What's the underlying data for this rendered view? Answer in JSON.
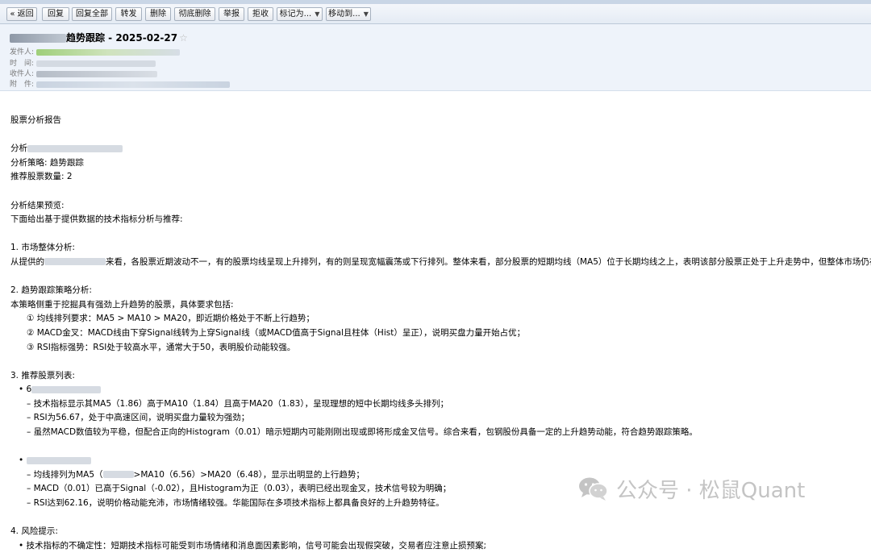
{
  "toolbar": {
    "back": "« 返回",
    "reply": "回复",
    "reply_all": "回复全部",
    "forward": "转发",
    "delete": "删除",
    "delete_perm": "彻底删除",
    "report": "举报",
    "reject": "拒收",
    "mark_as": "标记为...",
    "move_to": "移动到..."
  },
  "header": {
    "subject": "趋势跟踪 - 2025-02-27",
    "star": "☆",
    "from_label": "发件人:",
    "time_label": "时　间:",
    "to_label": "收件人:",
    "attach_label": "附　件:"
  },
  "body": {
    "title": "股票分析报告",
    "analysis_prefix": "分析",
    "strategy": "分析策略: 趋势跟踪",
    "count": "推荐股票数量: 2",
    "preview_title": "分析结果预览:",
    "preview_desc": "下面给出基于提供数据的技术指标分析与推荐:",
    "s1_title": "1. 市场整体分析:",
    "s1_prefix": "从提供的",
    "s1_text": "来看，各股票近期波动不一，有的股票均线呈现上升排列，有的则呈现宽幅震荡或下行排列。整体来看，部分股票的短期均线（MA5）位于长期均线之上，表明该部分股票正处于上升走势中，但整体市场仍存在分化现象，",
    "s2_title": "2. 趋势跟踪策略分析:",
    "s2_desc": "本策略侧重于挖掘具有强劲上升趋势的股票，具体要求包括:",
    "s2_items": [
      "① 均线排列要求：MA5 > MA10 > MA20，即近期价格处于不断上行趋势；",
      "② MACD金叉：MACD线由下穿Signal线转为上穿Signal线（或MACD值高于Signal且柱体（Hist）呈正），说明买盘力量开始占优；",
      "③ RSI指标强势：RSI处于较高水平，通常大于50，表明股价动能较强。"
    ],
    "s3_title": "3. 推荐股票列表:",
    "bullet": "•",
    "stock1_prefix": "6",
    "stock1_items": [
      "– 技术指标显示其MA5（1.86）高于MA10（1.84）且高于MA20（1.83），呈现理想的短中长期均线多头排列；",
      "– RSI为56.67，处于中高速区间，说明买盘力量较为强劲；",
      "– 虽然MACD数值较为平稳，但配合正向的Histogram（0.01）暗示短期内可能刚刚出现或即将形成金叉信号。综合来看，包钢股份具备一定的上升趋势动能，符合趋势跟踪策略。"
    ],
    "stock2_line1_a": "– 均线排列为MA5（",
    "stock2_line1_b": ">MA10（6.56）>MA20（6.48），显示出明显的上行趋势；",
    "stock2_items": [
      "– MACD（0.01）已高于Signal（-0.02），且Histogram为正（0.03），表明已经出现金叉，技术信号较为明确；",
      "– RSI达到62.16，说明价格动能充沛，市场情绪较强。华能国际在多项技术指标上都具备良好的上升趋势特征。"
    ],
    "s4_title": "4. 风险提示:",
    "s4_item": "• 技术指标的不确定性：短期技术指标可能受到市场情绪和消息面因素影响，信号可能会出现假突破，交易者应注意止损预案;"
  },
  "watermark": {
    "text": "公众号 · 松鼠Quant",
    "icon": "wechat-icon"
  },
  "colors": {
    "header_bg": "#eef3fa",
    "toolbar_bg": "#e4ebf4",
    "blur": "#cfd6e0",
    "watermark": "#c4c4c4"
  }
}
